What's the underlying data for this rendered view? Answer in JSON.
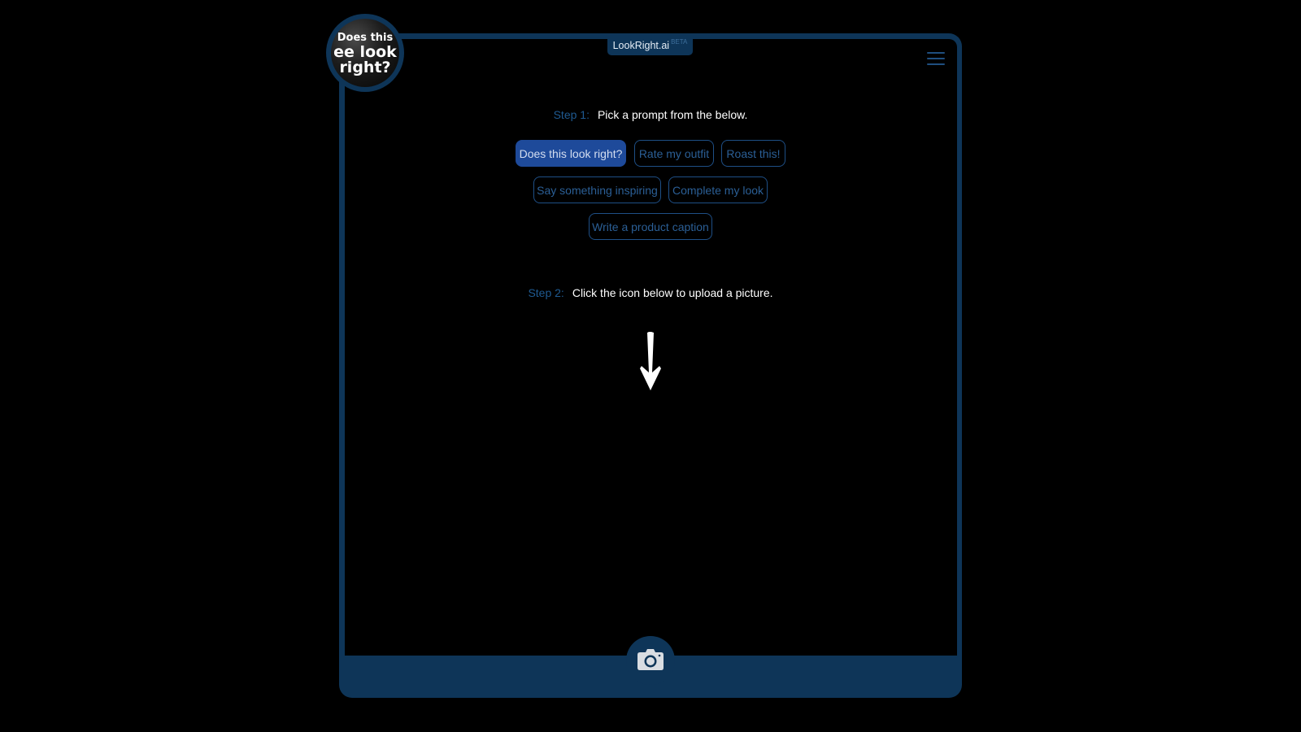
{
  "app": {
    "name": "LookRight.ai",
    "badge": "BETA"
  },
  "logo": {
    "line1": "Does this",
    "line2": "ee look",
    "line3": "right?"
  },
  "header": {
    "menu_icon": "hamburger-menu-icon"
  },
  "step1": {
    "label": "Step 1:",
    "text": "Pick a prompt from the below."
  },
  "prompts": [
    {
      "label": "Does this look right?",
      "selected": true
    },
    {
      "label": "Rate my outfit",
      "selected": false
    },
    {
      "label": "Roast this!",
      "selected": false
    },
    {
      "label": "Say something inspiring",
      "selected": false
    },
    {
      "label": "Complete my look",
      "selected": false
    },
    {
      "label": "Write a product caption",
      "selected": false
    }
  ],
  "step2": {
    "label": "Step 2:",
    "text": "Click the icon below to upload a picture."
  },
  "upload": {
    "icon": "camera-icon",
    "hint_icon": "arrow-down-icon"
  },
  "colors": {
    "frame": "#0e3558",
    "accent": "#1e4a9a",
    "chip_border": "#1e4f86",
    "step_label": "#1f5a91",
    "background": "#000000"
  }
}
